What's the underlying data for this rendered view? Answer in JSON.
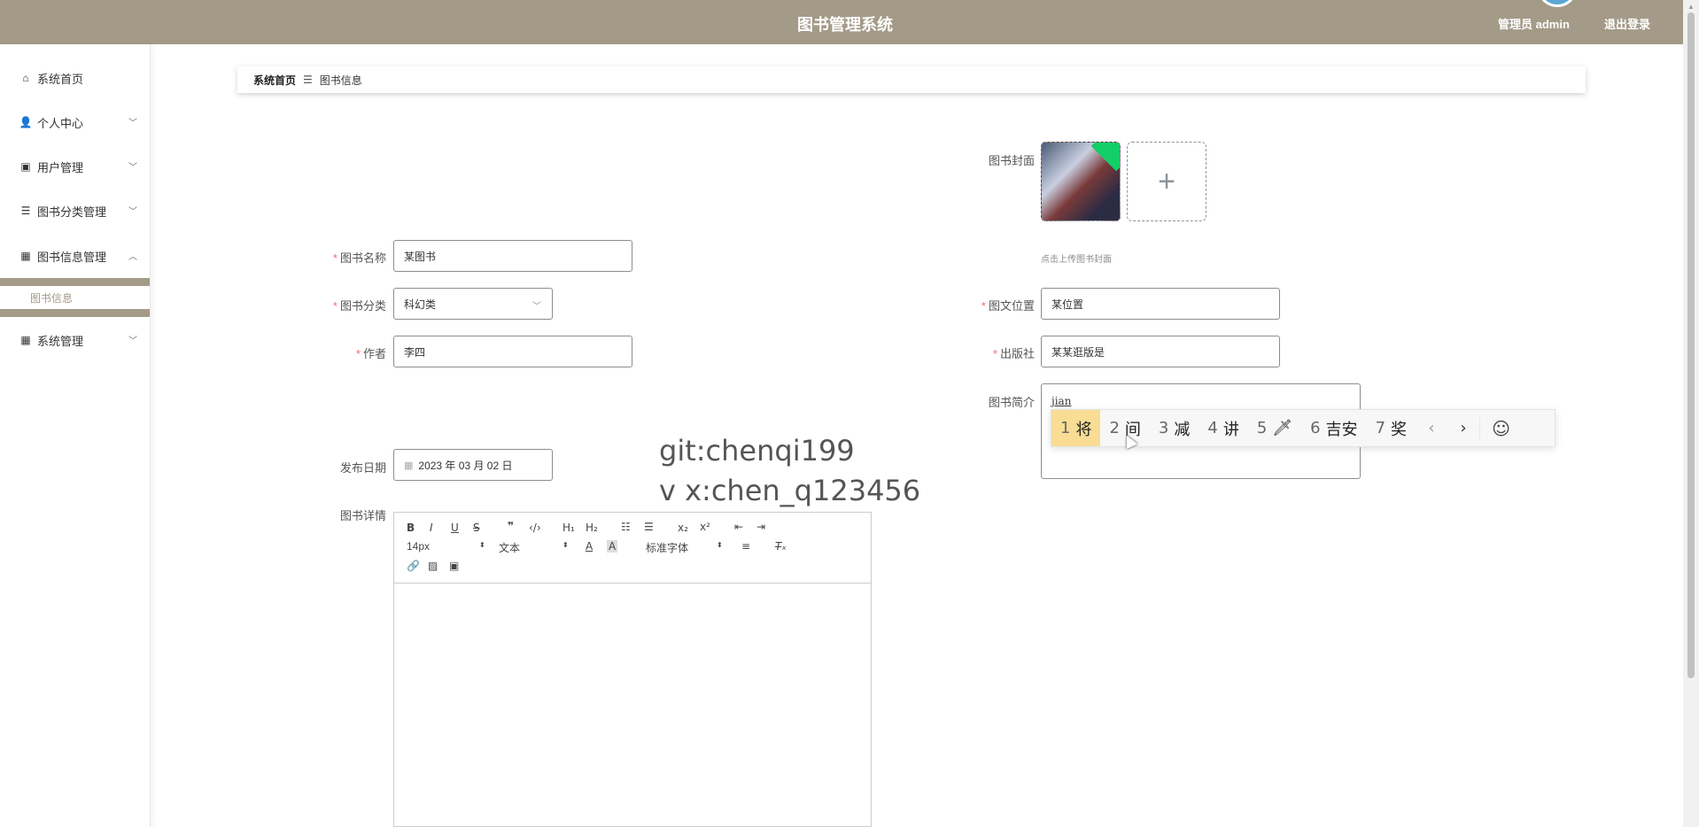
{
  "header": {
    "title": "图书管理系统",
    "user_label": "管理员 admin",
    "logout_label": "退出登录"
  },
  "sidebar": {
    "items": [
      {
        "label": "系统首页",
        "icon": "home-icon"
      },
      {
        "label": "个人中心",
        "icon": "user-icon"
      },
      {
        "label": "用户管理",
        "icon": "clipboard-icon"
      },
      {
        "label": "图书分类管理",
        "icon": "list-icon"
      },
      {
        "label": "图书信息管理",
        "icon": "grid-icon"
      },
      {
        "label": "系统管理",
        "icon": "grid-icon"
      }
    ],
    "active_sub": "图书信息"
  },
  "breadcrumb": {
    "home": "系统首页",
    "current": "图书信息"
  },
  "form": {
    "book_name": {
      "label": "图书名称",
      "value": "某图书"
    },
    "category": {
      "label": "图书分类",
      "value": "科幻类"
    },
    "author": {
      "label": "作者",
      "value": "李四"
    },
    "publish_date": {
      "label": "发布日期",
      "value": "2023 年 03 月 02 日"
    },
    "details": {
      "label": "图书详情"
    },
    "cover": {
      "label": "图书封面",
      "tip": "点击上传图书封面",
      "add": "+"
    },
    "location": {
      "label": "图文位置",
      "value": "某位置"
    },
    "publisher": {
      "label": "出版社",
      "value": "某某逛版是"
    },
    "summary": {
      "label": "图书简介",
      "value": "jian"
    }
  },
  "ime": {
    "candidates": [
      {
        "num": "1",
        "text": "将"
      },
      {
        "num": "2",
        "text": "间"
      },
      {
        "num": "3",
        "text": "减"
      },
      {
        "num": "4",
        "text": "讲"
      },
      {
        "num": "5",
        "text": "🗡"
      },
      {
        "num": "6",
        "text": "吉安"
      },
      {
        "num": "7",
        "text": "奖"
      }
    ],
    "prev": "‹",
    "next": "›",
    "emoji": "☺"
  },
  "watermark": {
    "line1": "git:chenqi199",
    "line2": "v x:chen_q123456"
  },
  "editor": {
    "font_size": "14px",
    "text_type": "文本",
    "font_family": "标准字体"
  },
  "colors": {
    "header_bg": "#a39a88",
    "required": "#f56c6c",
    "ime_selected": "#f9dd94"
  }
}
